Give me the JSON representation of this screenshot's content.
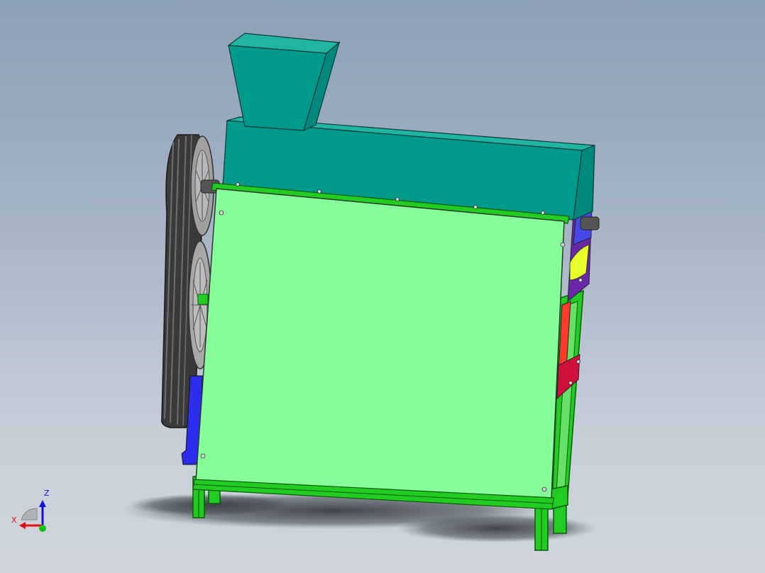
{
  "viewport": {
    "background_top": "#8c9fb6",
    "background_bottom": "#d0d5dc"
  },
  "model": {
    "parts": [
      {
        "name": "hopper",
        "color": "#009a8c"
      },
      {
        "name": "top-housing",
        "color": "#009a8c"
      },
      {
        "name": "front-panel",
        "color": "#86ff9b"
      },
      {
        "name": "frame",
        "color": "#22cc22"
      },
      {
        "name": "belt-pulley",
        "color": "#505050"
      },
      {
        "name": "side-bracket-blue",
        "color": "#2d2df0"
      },
      {
        "name": "side-plate-purple",
        "color": "#6a28a8"
      },
      {
        "name": "outlet-yellow",
        "color": "#e8ff2a"
      },
      {
        "name": "side-plate-red",
        "color": "#d0103c"
      }
    ]
  },
  "triad": {
    "z_label": "Z",
    "x_label": "X",
    "x_color": "#e01010",
    "z_color": "#1010e0",
    "y_color": "#10c010"
  }
}
